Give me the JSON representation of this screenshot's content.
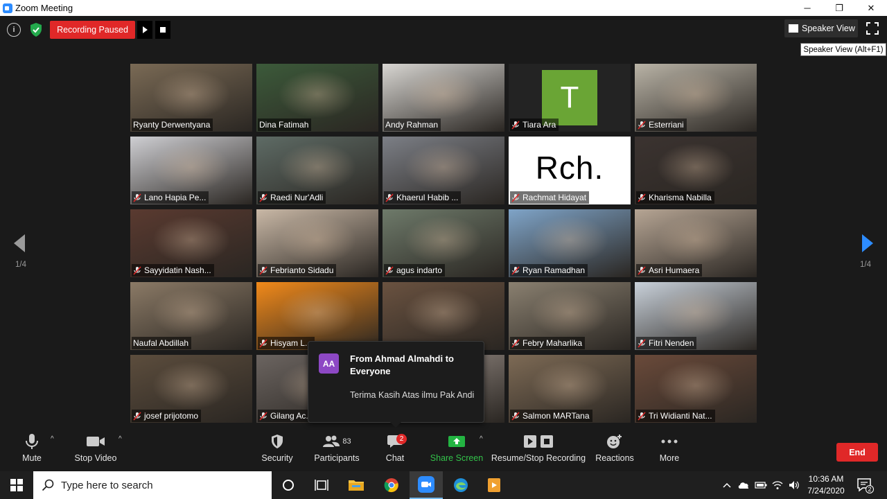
{
  "window": {
    "title": "Zoom Meeting",
    "minimize": "─",
    "restore": "❐",
    "close": "✕"
  },
  "top": {
    "info": "i",
    "recording_status": "Recording Paused",
    "speaker_view_label": "Speaker View",
    "tooltip": "Speaker View (Alt+F1)"
  },
  "pages": {
    "left": "1/4",
    "right": "1/4"
  },
  "participants": [
    {
      "name": "Ryanty Derwentyana",
      "muted": false,
      "active": false,
      "bg": "#7a6a55"
    },
    {
      "name": "Dina Fatimah",
      "muted": false,
      "active": true,
      "bg": "#3c5a3a"
    },
    {
      "name": "Andy Rahman",
      "muted": false,
      "active": false,
      "bg": "#d8d6d2"
    },
    {
      "name": "Tiara Ara",
      "muted": true,
      "active": false,
      "bg": "#232323",
      "avatar_letter": "T"
    },
    {
      "name": "Esterriani",
      "muted": true,
      "active": false,
      "bg": "#b9b3a6"
    },
    {
      "name": "Lano Hapia Pe...",
      "muted": true,
      "active": false,
      "bg": "#cfcfd3"
    },
    {
      "name": "Raedi Nur'Adli",
      "muted": true,
      "active": false,
      "bg": "#5e6b65"
    },
    {
      "name": "Khaerul Habib ...",
      "muted": true,
      "active": false,
      "bg": "#7c7f86"
    },
    {
      "name": "Rachmat Hidayat",
      "muted": true,
      "active": false,
      "bg": "#ffffff",
      "avatar_text": "Rch."
    },
    {
      "name": "Kharisma Nabilla",
      "muted": true,
      "active": false,
      "bg": "#3b3330"
    },
    {
      "name": "Sayyidatin Nash...",
      "muted": true,
      "active": false,
      "bg": "#5a3a30"
    },
    {
      "name": "Febrianto Sidadu",
      "muted": true,
      "active": false,
      "bg": "#c9b8a6"
    },
    {
      "name": "agus indarto",
      "muted": true,
      "active": false,
      "bg": "#6e7a6a"
    },
    {
      "name": "Ryan Ramadhan",
      "muted": true,
      "active": false,
      "bg": "#7fa4c8"
    },
    {
      "name": "Asri Humaera",
      "muted": true,
      "active": false,
      "bg": "#b6a594"
    },
    {
      "name": "Naufal Abdillah",
      "muted": false,
      "active": false,
      "bg": "#8b7a66"
    },
    {
      "name": "Hisyam L...",
      "muted": true,
      "active": false,
      "bg": "#f28a1a"
    },
    {
      "name": "",
      "muted": false,
      "active": false,
      "bg": "#6a5240"
    },
    {
      "name": "Febry Maharlika",
      "muted": true,
      "active": false,
      "bg": "#8a8070"
    },
    {
      "name": "Fitri Nenden",
      "muted": true,
      "active": false,
      "bg": "#c9d1da"
    },
    {
      "name": "josef prijotomo",
      "muted": true,
      "active": false,
      "bg": "#5c4d3d"
    },
    {
      "name": "Gilang Ac...",
      "muted": true,
      "active": false,
      "bg": "#6b6460"
    },
    {
      "name": "",
      "muted": false,
      "active": false,
      "bg": "#9a8f88"
    },
    {
      "name": "Salmon MARTana",
      "muted": true,
      "active": false,
      "bg": "#7d6a55"
    },
    {
      "name": "Tri Widianti Nat...",
      "muted": true,
      "active": false,
      "bg": "#6a4a3a"
    }
  ],
  "chat_popup": {
    "avatar": "AA",
    "from": "From Ahmad Almahdi to Everyone",
    "message": "Terima Kasih Atas ilmu Pak Andi"
  },
  "toolbar": {
    "mute": "Mute",
    "stop_video": "Stop Video",
    "security": "Security",
    "participants": "Participants",
    "participants_count": "83",
    "chat": "Chat",
    "chat_badge": "2",
    "share_screen": "Share Screen",
    "recording": "Resume/Stop Recording",
    "reactions": "Reactions",
    "more": "More",
    "end": "End",
    "caret": "^"
  },
  "taskbar": {
    "search_placeholder": "Type here to search",
    "time": "10:36 AM",
    "date": "7/24/2020",
    "notification_count": "2"
  },
  "colors": {
    "accent_red": "#e02828",
    "share_green": "#33c24a",
    "zoom_blue": "#2d8cff",
    "active_speaker": "#e8e23a"
  }
}
